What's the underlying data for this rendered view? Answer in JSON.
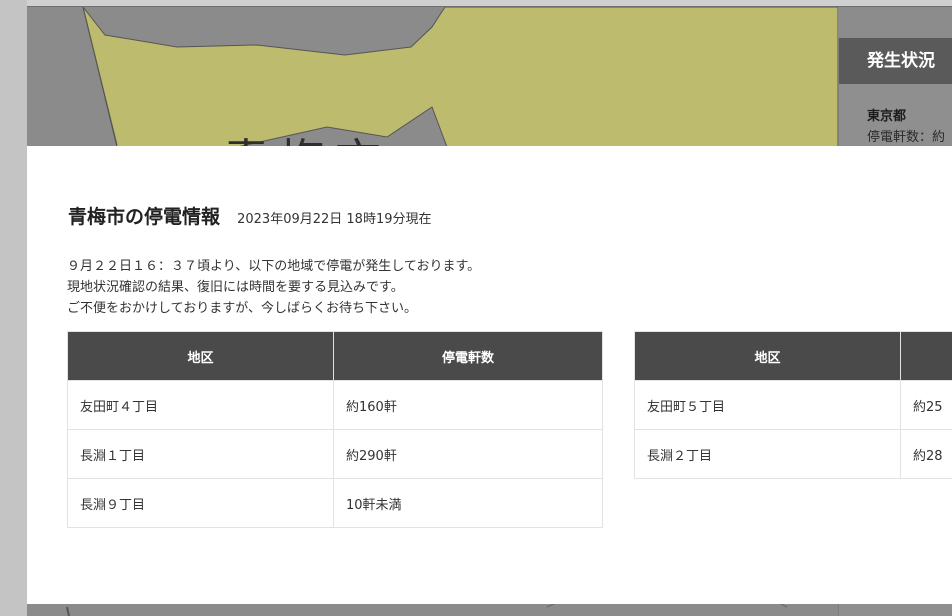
{
  "background": {
    "map_label": "青梅市",
    "status_panel": {
      "header": "発生状況",
      "region": "東京都",
      "count_text": "停電軒数：約"
    }
  },
  "modal": {
    "title": "青梅市の停電情報",
    "timestamp": "2023年09月22日 18時19分現在",
    "notice_lines": [
      "９月２２日１６：３７頃より、以下の地域で停電が発生しております。",
      "現地状況確認の結果、復旧には時間を要する見込みです。",
      "ご不便をおかけしておりますが、今しばらくお待ち下さい。"
    ],
    "table_left": {
      "headers": [
        "地区",
        "停電軒数"
      ],
      "rows": [
        [
          "友田町４丁目",
          "約160軒"
        ],
        [
          "長淵１丁目",
          "約290軒"
        ],
        [
          "長淵９丁目",
          "10軒未満"
        ]
      ]
    },
    "table_right": {
      "headers": [
        "地区",
        ""
      ],
      "rows": [
        [
          "友田町５丁目",
          "約25"
        ],
        [
          "長淵２丁目",
          "約28"
        ]
      ]
    }
  },
  "colors": {
    "map_fill": "#bdbb6e",
    "header_bg": "#4a4a4a",
    "overlay_bg": "#8c8c8c"
  }
}
